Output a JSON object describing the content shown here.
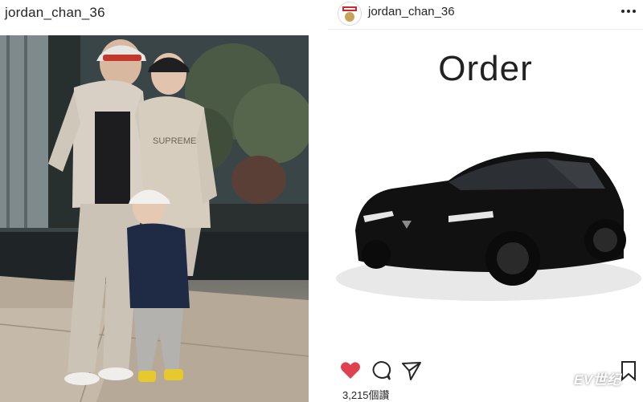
{
  "left_post": {
    "username": "jordan_chan_36",
    "photo_icon": "family-photo-image"
  },
  "right_post": {
    "username": "jordan_chan_36",
    "title": "Order",
    "likes": "3,215個讚",
    "watermark": "EV世纪",
    "icons": {
      "avatar": "supreme-avatar-icon",
      "more": "more-options-icon",
      "like": "heart-icon",
      "comment": "comment-icon",
      "share": "send-icon",
      "save": "bookmark-icon"
    }
  },
  "colors": {
    "like": "#e0414f",
    "text": "#262626",
    "car": "#111111"
  }
}
